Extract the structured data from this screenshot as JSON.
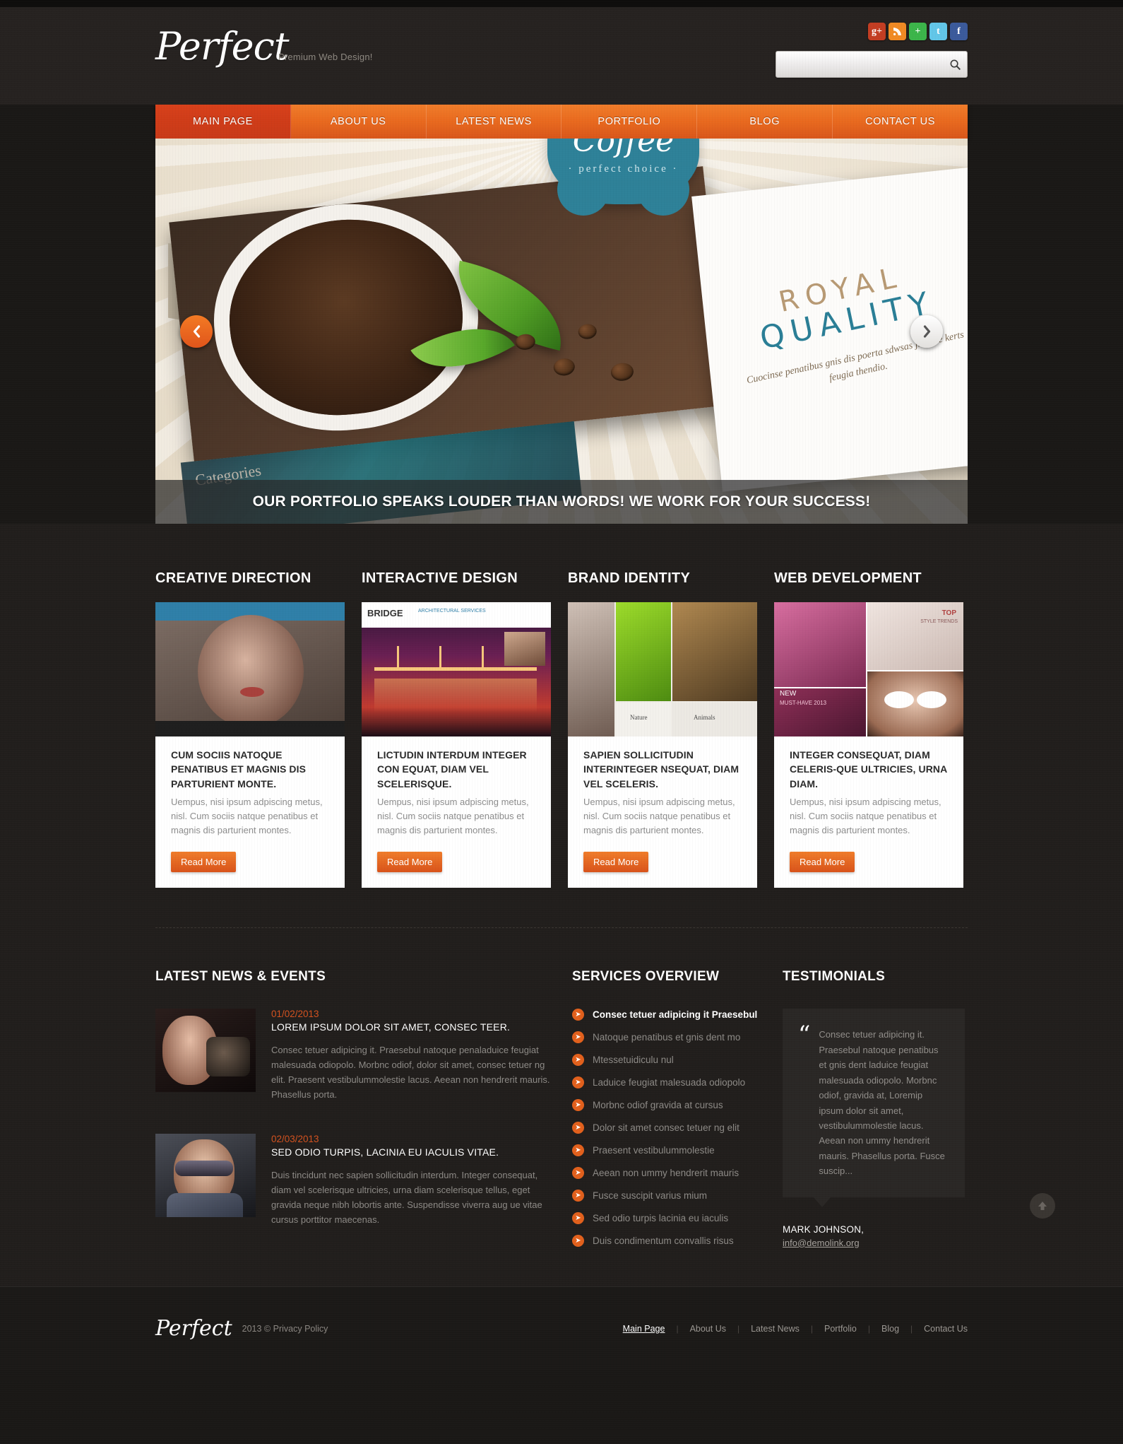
{
  "site": {
    "logo": "Perfect",
    "tagline": "Premium Web Design!"
  },
  "header": {
    "search_placeholder": "",
    "search_value": "",
    "search_icon": "search-icon",
    "social": [
      {
        "name": "google-plus-icon",
        "glyph": "g+",
        "color": "#c33d22"
      },
      {
        "name": "rss-icon",
        "glyph": "≋",
        "color": "#f08a24"
      },
      {
        "name": "share-icon",
        "glyph": "+",
        "color": "#3cb54a"
      },
      {
        "name": "twitter-icon",
        "glyph": "t",
        "color": "#62c6e8"
      },
      {
        "name": "facebook-icon",
        "glyph": "f",
        "color": "#3b5a9b"
      }
    ]
  },
  "nav": {
    "items": [
      {
        "label": "MAIN PAGE",
        "active": true
      },
      {
        "label": "ABOUT US",
        "active": false
      },
      {
        "label": "LATEST NEWS",
        "active": false
      },
      {
        "label": "PORTFOLIO",
        "active": false
      },
      {
        "label": "BLOG",
        "active": false
      },
      {
        "label": "CONTACT US",
        "active": false
      }
    ]
  },
  "slider": {
    "caption": "OUR PORTFOLIO SPEAKS LOUDER THAN WORDS! WE WORK FOR YOUR SUCCESS!",
    "prev_icon": "chevron-left-icon",
    "next_icon": "chevron-right-icon",
    "badge_word": "Coffee",
    "badge_sub": "· perfect choice ·",
    "poster_line1": "ROYAL",
    "poster_line2": "QUALITY",
    "poster_sub": "Cuocinse penatibus gnis dis poerta sdwsas jretswe kerts feugia thendio.",
    "strip_label": "Categories"
  },
  "services_cards": [
    {
      "heading": "CREATIVE DIRECTION",
      "thumb": "creative-direction-thumb",
      "title": "CUM SOCIIS NATOQUE PENATIBUS ET MAGNIS DIS PARTURIENT MONTE.",
      "text": "Uempus, nisi ipsum adpiscing metus, nisl. Cum sociis natque penatibus et magnis dis parturient montes.",
      "button": "Read More"
    },
    {
      "heading": "INTERACTIVE DESIGN",
      "thumb": "interactive-design-thumb",
      "title": "LICTUDIN INTERDUM INTEGER CON EQUAT, DIAM VEL SCELERISQUE.",
      "text": "Uempus, nisi ipsum adpiscing metus, nisl. Cum sociis natque penatibus et magnis dis parturient montes.",
      "button": "Read More"
    },
    {
      "heading": "BRAND IDENTITY",
      "thumb": "brand-identity-thumb",
      "title": "SAPIEN SOLLICITUDIN INTERINTEGER NSEQUAT, DIAM VEL SCELERIS.",
      "text": "Uempus, nisi ipsum adpiscing metus, nisl. Cum sociis natque penatibus et magnis dis parturient montes.",
      "button": "Read More"
    },
    {
      "heading": "WEB DEVELOPMENT",
      "thumb": "web-development-thumb",
      "title": "INTEGER CONSEQUAT, DIAM CELERIS-QUE ULTRICIES, URNA DIAM.",
      "text": "Uempus, nisi ipsum adpiscing metus, nisl. Cum sociis natque penatibus et magnis dis parturient montes.",
      "button": "Read More"
    }
  ],
  "news": {
    "title": "LATEST NEWS & EVENTS",
    "items": [
      {
        "date": "01/02/2013",
        "title": "LOREM IPSUM DOLOR SIT AMET, CONSEC TEER.",
        "text": "Consec tetuer adipicing it. Praesebul natoque penaladuice feugiat  malesuada odiopolo. Morbnc odiof,  dolor sit amet, consec tetuer ng elit. Praesent vestibulummolestie lacus. Aeean non hendrerit mauris. Phasellus porta."
      },
      {
        "date": "02/03/2013",
        "title": "SED ODIO TURPIS, LACINIA EU IACULIS VITAE.",
        "text": "Duis tincidunt nec sapien sollicitudin interdum. Integer consequat, diam vel scelerisque ultricies, urna diam scelerisque tellus, eget gravida neque nibh lobortis ante. Suspendisse viverra aug ue vitae cursus porttitor maecenas."
      }
    ]
  },
  "services_overview": {
    "title": "SERVICES OVERVIEW",
    "items": [
      {
        "label": "Consec tetuer adipicing it Praesebul",
        "active": true
      },
      {
        "label": "Natoque penatibus et gnis dent mo",
        "active": false
      },
      {
        "label": "Mtessetuidiculu nul",
        "active": false
      },
      {
        "label": "Laduice feugiat  malesuada odiopolo",
        "active": false
      },
      {
        "label": "Morbnc odiof  gravida at cursus",
        "active": false
      },
      {
        "label": "Dolor sit amet consec tetuer ng elit",
        "active": false
      },
      {
        "label": "Praesent vestibulummolestie",
        "active": false
      },
      {
        "label": "Aeean non ummy hendrerit mauris",
        "active": false
      },
      {
        "label": "Fusce suscipit varius mium",
        "active": false
      },
      {
        "label": "Sed odio turpis lacinia eu iaculis",
        "active": false
      },
      {
        "label": "Duis condimentum convallis risus",
        "active": false
      }
    ]
  },
  "testimonials": {
    "title": "TESTIMONIALS",
    "quote_mark": "“",
    "quote": "Consec tetuer adipicing it. Praesebul natoque penatibus et gnis dent laduice feugiat  malesuada odiopolo. Morbnc odiof,  gravida at, Loremip ipsum dolor sit amet, vestibulummolestie lacus. Aeean non ummy hendrerit mauris. Phasellus porta. Fusce suscip...",
    "author": "MARK JOHNSON,",
    "email": "info@demolink.org"
  },
  "back_to_top": {
    "icon": "arrow-up-icon",
    "label": "↑"
  },
  "footer": {
    "logo": "Perfect",
    "copyright": "2013 © Privacy Policy",
    "links": [
      {
        "label": "Main Page",
        "current": true
      },
      {
        "label": "About Us",
        "current": false
      },
      {
        "label": "Latest News",
        "current": false
      },
      {
        "label": "Portfolio",
        "current": false
      },
      {
        "label": "Blog",
        "current": false
      },
      {
        "label": "Contact Us",
        "current": false
      }
    ],
    "separator": "|"
  },
  "colors": {
    "accent": "#e2601c",
    "accent_dark": "#d8401a",
    "page_bg": "#211e1c",
    "header_bg": "#262220"
  }
}
